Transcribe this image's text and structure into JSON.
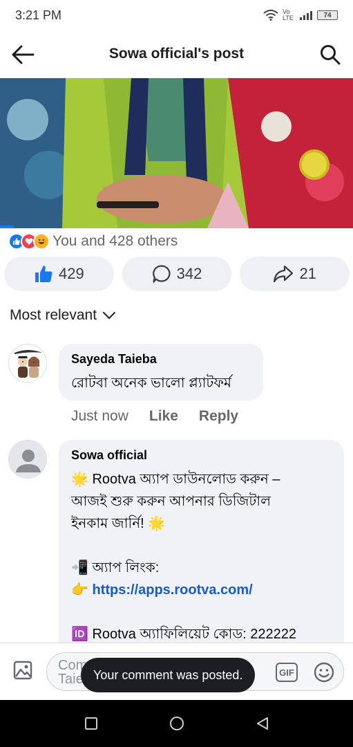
{
  "status_bar": {
    "time": "3:21 PM",
    "network": "Vo LTE",
    "battery": "74"
  },
  "header": {
    "title": "Sowa official's post"
  },
  "media": {
    "progress": 0.04
  },
  "reactions": {
    "summary": "You and 428 others"
  },
  "actions": {
    "likes": "429",
    "comments": "342",
    "shares": "21"
  },
  "sort": {
    "label": "Most relevant"
  },
  "comments": [
    {
      "author": "Sayeda Taieba",
      "lines": [
        "রোটবা অনেক ভালো প্ল্যাটফর্ম"
      ],
      "time": "Just now",
      "like": "Like",
      "reply": "Reply"
    },
    {
      "author": "Sowa official",
      "lines": [
        "🌟 Rootva অ্যাপ ডাউনলোড করুন –",
        "আজই শুরু করুন আপনার ডিজিটাল",
        "ইনকাম জার্নি! 🌟",
        "",
        "📲 অ্যাপ লিংক:",
        "👉",
        "",
        "🆔 Rootva অ্যাফিলিয়েট কোড: 222222"
      ],
      "link": "https://apps.rootva.com/"
    }
  ],
  "composer": {
    "placeholder_line1": "Com",
    "placeholder_line2": "Taie",
    "gif_label": "GIF"
  },
  "toast": {
    "text": "Your comment was posted."
  },
  "colors": {
    "accent": "#1877f2",
    "link": "#1a5cc2",
    "secondary_text": "#65676b"
  }
}
